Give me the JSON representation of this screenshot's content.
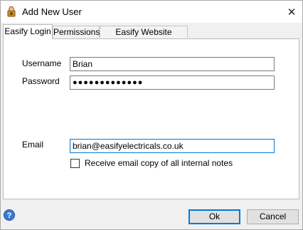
{
  "window": {
    "title": "Add New User",
    "close_glyph": "✕"
  },
  "tabs": [
    {
      "label": "Easify Login",
      "active": true
    },
    {
      "label": "Permissions",
      "active": false
    },
    {
      "label": "Easify Website Account",
      "active": false
    }
  ],
  "form": {
    "username_label": "Username",
    "username_value": "Brian",
    "password_label": "Password",
    "password_value": "●●●●●●●●●●●●●",
    "email_label": "Email",
    "email_value": "brian@easifyelectricals.co.uk",
    "email_copy_label": "Receive email copy of all internal notes",
    "email_copy_checked": false
  },
  "buttons": {
    "ok_label": "Ok",
    "cancel_label": "Cancel"
  },
  "icons": {
    "app": "user-lock-icon",
    "help": "help-icon",
    "close": "close-icon"
  },
  "colors": {
    "accent": "#0078d7",
    "help_blue": "#3a7bd5"
  }
}
